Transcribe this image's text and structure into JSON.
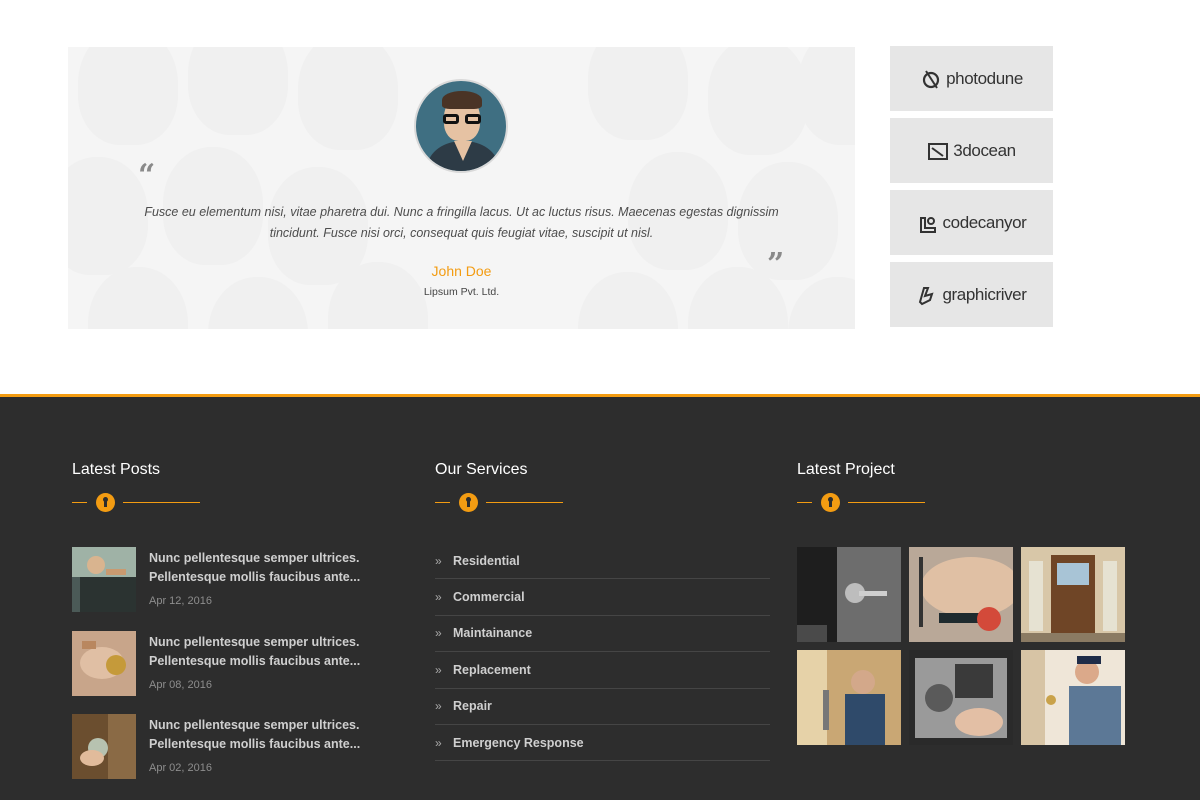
{
  "testimonial": {
    "quote": "Fusce eu elementum nisi, vitae pharetra dui. Nunc a fringilla lacus. Ut ac luctus risus. Maecenas egestas dignissim tincidunt. Fusce nisi orci, consequat quis feugiat vitae, suscipit ut nisl.",
    "author": "John Doe",
    "company": "Lipsum Pvt. Ltd.",
    "quote_open": "“",
    "quote_close": "”"
  },
  "brands": [
    "photodune",
    "3docean",
    "codecanyor",
    "graphicriver"
  ],
  "footer": {
    "accent_color": "#f39c12",
    "latest_posts": {
      "title": "Latest Posts",
      "items": [
        {
          "title": "Nunc pellentesque semper ultrices. Pellentesque mollis faucibus ante...",
          "date": "Apr 12, 2016"
        },
        {
          "title": "Nunc pellentesque semper ultrices. Pellentesque mollis faucibus ante...",
          "date": "Apr 08, 2016"
        },
        {
          "title": "Nunc pellentesque semper ultrices. Pellentesque mollis faucibus ante...",
          "date": "Apr 02, 2016"
        }
      ]
    },
    "our_services": {
      "title": "Our Services",
      "items": [
        "Residential",
        "Commercial",
        "Maintainance",
        "Replacement",
        "Repair",
        "Emergency Response"
      ]
    },
    "latest_project": {
      "title": "Latest Project"
    }
  }
}
